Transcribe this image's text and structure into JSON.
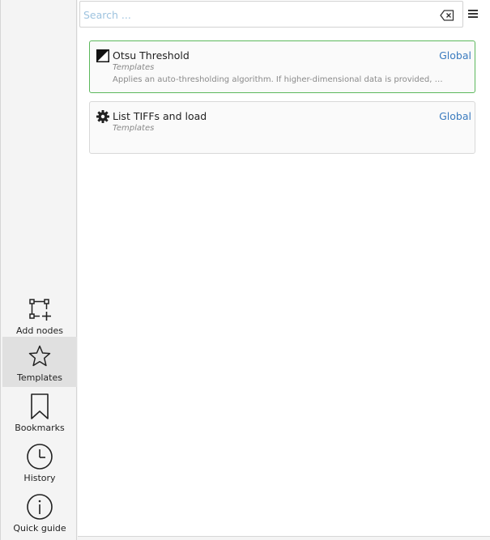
{
  "search": {
    "placeholder": "Search ...",
    "value": ""
  },
  "sidebar": {
    "items": [
      {
        "label": "Add nodes",
        "icon": "add-nodes-icon"
      },
      {
        "label": "Templates",
        "icon": "star-icon",
        "active": true
      },
      {
        "label": "Bookmarks",
        "icon": "bookmark-icon"
      },
      {
        "label": "History",
        "icon": "clock-icon"
      },
      {
        "label": "Quick guide",
        "icon": "info-icon"
      }
    ]
  },
  "results": [
    {
      "title": "Otsu Threshold",
      "category": "Templates",
      "description": "Applies an auto-thresholding algorithm. If higher-dimensional data is provided, th…",
      "scope": "Global",
      "icon": "threshold-icon",
      "selected": true
    },
    {
      "title": "List TIFFs and load",
      "category": "Templates",
      "description": "",
      "scope": "Global",
      "icon": "gear-icon",
      "selected": false
    }
  ],
  "colors": {
    "accent": "#3a7bbf",
    "selected_border": "#5cb85c",
    "placeholder": "#9ec3df"
  }
}
